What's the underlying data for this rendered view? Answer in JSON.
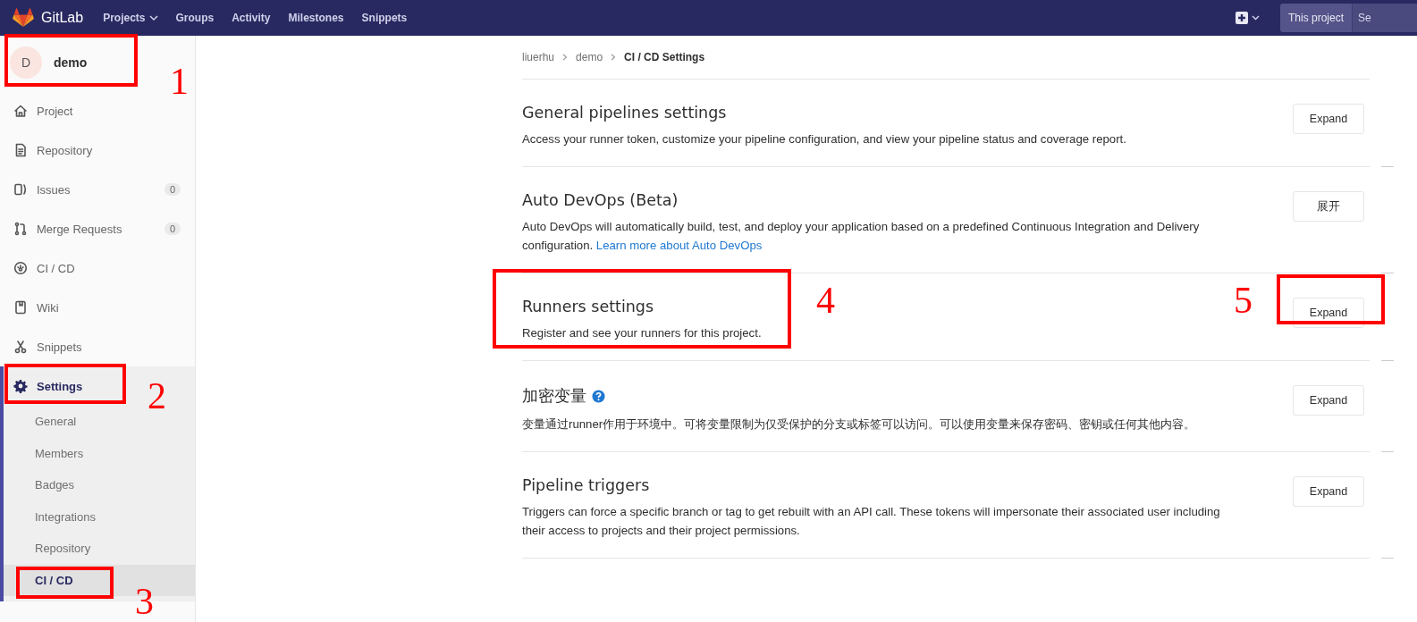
{
  "navbar": {
    "brand": "GitLab",
    "links": [
      {
        "label": "Projects",
        "dropdown": true
      },
      {
        "label": "Groups",
        "dropdown": false
      },
      {
        "label": "Activity",
        "dropdown": false
      },
      {
        "label": "Milestones",
        "dropdown": false
      },
      {
        "label": "Snippets",
        "dropdown": false
      }
    ],
    "search_scope": "This project",
    "search_placeholder": "Se"
  },
  "sidebar": {
    "project": {
      "avatar": "D",
      "name": "demo"
    },
    "items": [
      {
        "label": "Project",
        "selected": false
      },
      {
        "label": "Repository",
        "selected": false
      },
      {
        "label": "Issues",
        "count": "0",
        "selected": false
      },
      {
        "label": "Merge Requests",
        "count": "0",
        "selected": false
      },
      {
        "label": "CI / CD",
        "selected": false
      },
      {
        "label": "Wiki",
        "selected": false
      },
      {
        "label": "Snippets",
        "selected": false
      },
      {
        "label": "Settings",
        "selected": true,
        "expanded": true,
        "children": [
          {
            "label": "General",
            "selected": false
          },
          {
            "label": "Members",
            "selected": false
          },
          {
            "label": "Badges",
            "selected": false
          },
          {
            "label": "Integrations",
            "selected": false
          },
          {
            "label": "Repository",
            "selected": false
          },
          {
            "label": "CI / CD",
            "selected": true
          }
        ]
      }
    ]
  },
  "breadcrumb": [
    "liuerhu",
    "demo",
    "CI / CD Settings"
  ],
  "sections": [
    {
      "title": "General pipelines settings",
      "description": "Access your runner token, customize your pipeline configuration, and view your pipeline status and coverage report.",
      "button": "Expand"
    },
    {
      "title": "Auto DevOps (Beta)",
      "description": "Auto DevOps will automatically build, test, and deploy your application based on a predefined Continuous Integration and Delivery configuration.",
      "link": "Learn more about Auto DevOps",
      "button": "展开"
    },
    {
      "title": "Runners settings",
      "description": "Register and see your runners for this project.",
      "button": "Expand"
    },
    {
      "title": "加密变量",
      "help": true,
      "description": "变量通过runner作用于环境中。可将变量限制为仅受保护的分支或标签可以访问。可以使用变量来保存密码、密钥或任何其他内容。",
      "button": "Expand"
    },
    {
      "title": "Pipeline triggers",
      "description": "Triggers can force a specific branch or tag to get rebuilt with an API call. These tokens will impersonate their associated user including their access to projects and their project permissions.",
      "button": "Expand"
    }
  ],
  "annotations": [
    {
      "label": "1"
    },
    {
      "label": "2"
    },
    {
      "label": "3"
    },
    {
      "label": "4"
    },
    {
      "label": "5"
    }
  ]
}
